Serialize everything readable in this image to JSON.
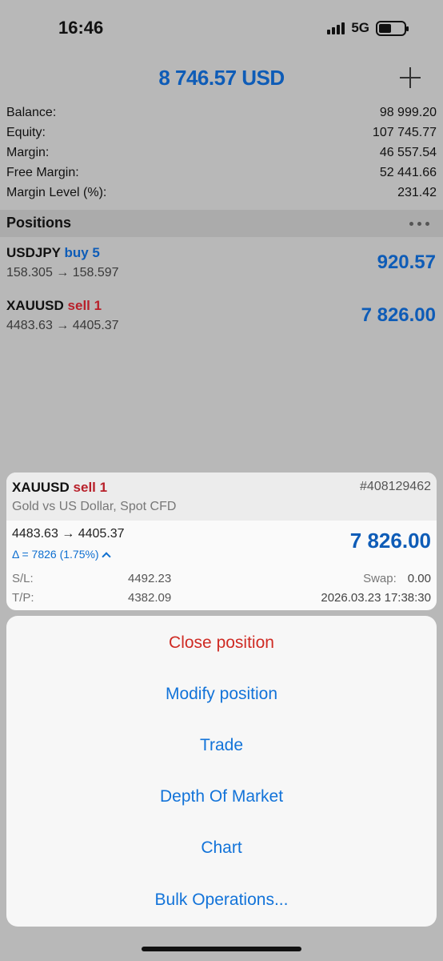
{
  "status": {
    "time": "16:46",
    "network": "5G",
    "battery_level": 0.5
  },
  "header": {
    "title": "8 746.57 USD",
    "add_icon": "plus-icon"
  },
  "summary": [
    {
      "label": "Balance:",
      "value": "98 999.20"
    },
    {
      "label": "Equity:",
      "value": "107 745.77"
    },
    {
      "label": "Margin:",
      "value": "46 557.54"
    },
    {
      "label": "Free Margin:",
      "value": "52 441.66"
    },
    {
      "label": "Margin Level (%):",
      "value": "231.42"
    }
  ],
  "positions": {
    "title": "Positions",
    "menu_icon": "more-dots-icon",
    "items": [
      {
        "symbol": "USDJPY",
        "side": "buy 5",
        "side_type": "buy",
        "prices": "158.305 → 158.597",
        "profit": "920.57"
      },
      {
        "symbol": "XAUUSD",
        "side": "sell 1",
        "side_type": "sell",
        "prices": "4483.63 → 4405.37",
        "profit": "7 826.00"
      }
    ]
  },
  "detail": {
    "symbol": "XAUUSD",
    "side": "sell 1",
    "ticket": "#408129462",
    "description": "Gold vs US Dollar, Spot CFD",
    "prices": "4483.63 → 4405.37",
    "profit": "7 826.00",
    "delta": "Δ = 7826 (1.75%)",
    "sl_label": "S/L:",
    "sl_value": "4492.23",
    "swap_label": "Swap:",
    "swap_value": "0.00",
    "tp_label": "T/P:",
    "tp_value": "4382.09",
    "open_time": "2026.03.23 17:38:30"
  },
  "actions": [
    {
      "label": "Close position",
      "danger": true
    },
    {
      "label": "Modify position",
      "danger": false
    },
    {
      "label": "Trade",
      "danger": false
    },
    {
      "label": "Depth Of Market",
      "danger": false
    },
    {
      "label": "Chart",
      "danger": false
    },
    {
      "label": "Bulk Operations...",
      "danger": false
    }
  ],
  "colors": {
    "accent": "#1273d9",
    "profit": "#0e5cb7",
    "sell": "#b8202a",
    "danger": "#cf2b24"
  }
}
